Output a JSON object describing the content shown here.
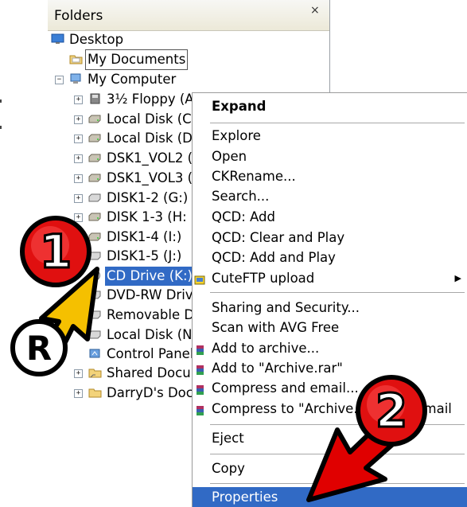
{
  "pane": {
    "title": "Folders",
    "close": "×"
  },
  "tree": [
    {
      "label": "Desktop",
      "icon": "desktop-icon"
    },
    {
      "label": "My Documents",
      "icon": "my-documents-icon"
    },
    {
      "label": "My Computer",
      "icon": "my-computer-icon"
    },
    {
      "label": "3½ Floppy (A",
      "icon": "floppy-drive-icon"
    },
    {
      "label": "Local Disk (C:",
      "icon": "local-disk-icon"
    },
    {
      "label": "Local Disk (D",
      "icon": "local-disk-icon"
    },
    {
      "label": "DSK1_VOL2 (",
      "icon": "local-disk-icon"
    },
    {
      "label": "DSK1_VOL3 (",
      "icon": "local-disk-icon"
    },
    {
      "label": "DISK1-2 (G:)",
      "icon": "local-disk-icon"
    },
    {
      "label": "DISK 1-3 (H:",
      "icon": "local-disk-icon"
    },
    {
      "label": "DISK1-4 (I:)",
      "icon": "local-disk-icon"
    },
    {
      "label": "DISK1-5 (J:)",
      "icon": "local-disk-icon"
    },
    {
      "label": "CD Drive (K:)",
      "icon": "cd-drive-icon"
    },
    {
      "label": "DVD-RW Driv",
      "icon": "dvd-drive-icon"
    },
    {
      "label": "Removable D",
      "icon": "removable-disk-icon"
    },
    {
      "label": "Local Disk (N",
      "icon": "local-disk-icon"
    },
    {
      "label": "Control Panel",
      "icon": "control-panel-icon"
    },
    {
      "label": "Shared Docu",
      "icon": "shared-folder-icon"
    },
    {
      "label": "DarryD's Doc",
      "icon": "folder-icon"
    }
  ],
  "menu": {
    "expand": "Expand",
    "explore": "Explore",
    "open": "Open",
    "ckrename": "CKRename...",
    "search": "Search...",
    "qcd_add": "QCD: Add",
    "qcd_clear_play": "QCD: Clear and Play",
    "qcd_add_play": "QCD: Add and Play",
    "cuteftp": "CuteFTP upload",
    "sharing": "Sharing and Security...",
    "scan_avg": "Scan with AVG Free",
    "add_archive": "Add to archive...",
    "add_archive_rar": "Add to \"Archive.rar\"",
    "compress_email": "Compress and email...",
    "compress_to": "Compress to \"Archive.rar\" and email",
    "eject": "Eject",
    "copy": "Copy",
    "properties": "Properties"
  },
  "annotations": {
    "step1": "1",
    "step2": "2",
    "right_click": "R"
  },
  "colors": {
    "selection": "#316ac5",
    "badge_red": "#e01010",
    "arrow_yellow": "#f5c000",
    "arrow_red": "#e00000"
  }
}
